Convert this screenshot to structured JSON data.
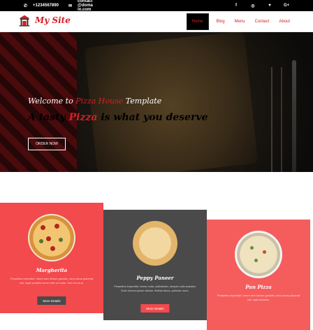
{
  "topbar": {
    "phone": "+1234567890",
    "email": "contact@domain.com",
    "social": [
      "f",
      "◎",
      "♥",
      "G+"
    ]
  },
  "header": {
    "logo_text": "My Site",
    "nav": [
      "Home",
      "Blog",
      "Menu",
      "Contact",
      "About"
    ]
  },
  "hero": {
    "line1_a": "Welcome to ",
    "line1_brand": "Pizza House",
    "line1_b": " Template",
    "line2_a": "A tasty ",
    "line2_pizza": "Pizza",
    "line2_b": " is what you deserve",
    "order_button": "ORDER NOW"
  },
  "cards": [
    {
      "title": "Margherita",
      "description": "Phasellus imperdiet, lorem sed dictum gravida, nunc lacus placerat nisi, eget sodales lorem velit vel nulla. Sed vel urna.",
      "button": "More Details"
    },
    {
      "title": "Peppy Paneer",
      "description": "Phasellus imperdiet, lorem nulla, sollicitudin, semper odio sodales. Duis viverra ipsum dictum, finibus lacus, pulvinar nunc.",
      "button": "More Details"
    },
    {
      "title": "Pan Pizza",
      "description": "Phasellus imperdiet, lorem sed dictum gravida, nunc lacus placerat nisi, eget sodales.",
      "button": ""
    }
  ],
  "colors": {
    "accent": "#d51f24",
    "card1": "#f24a4d",
    "card2": "#4a4a4a",
    "card3": "#f55d5d"
  }
}
